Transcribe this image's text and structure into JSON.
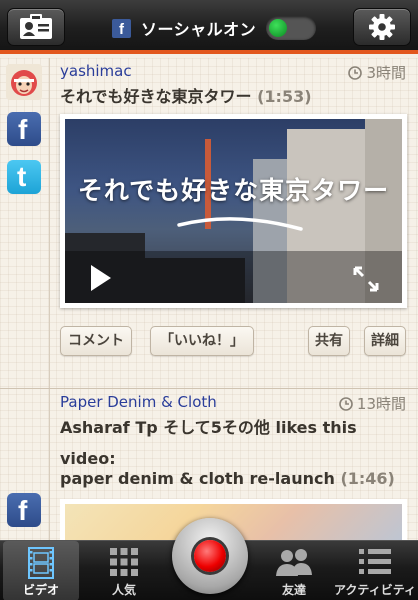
{
  "header": {
    "social_label": "ソーシャルオン",
    "toggle_on": true,
    "accent_color": "#e2571e"
  },
  "posts": [
    {
      "username": "yashimac",
      "time": "3時間",
      "title": "それでも好きな東京タワー",
      "duration": "(1:53)",
      "video_title": "それでも好きな東京タワー",
      "actions": {
        "comment": "コメント",
        "like": "「いいね！」",
        "share": "共有",
        "details": "詳細"
      }
    },
    {
      "username": "Paper Denim  & Cloth",
      "time": "13時間",
      "title_line1": "Asharaf Tp そして5その他 likes this",
      "title_line2": "video:",
      "title_line3": "paper denim & cloth re-launch",
      "duration": "(1:46)"
    }
  ],
  "tabs": [
    {
      "label": "ビデオ",
      "icon": "film-icon",
      "active": true
    },
    {
      "label": "人気",
      "icon": "grid-icon",
      "active": false
    },
    {
      "label": "友達",
      "icon": "friends-icon",
      "active": false
    },
    {
      "label": "アクティビティ",
      "icon": "list-icon",
      "active": false
    }
  ]
}
